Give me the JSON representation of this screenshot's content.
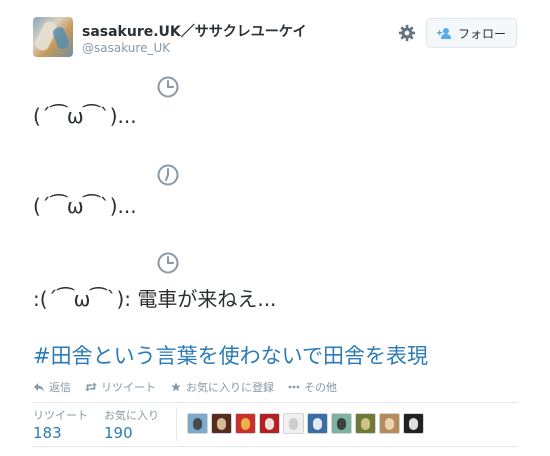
{
  "user": {
    "display_name": "sasakure.UK／ササクレユーケイ",
    "username": "@sasakure_UK",
    "follow_label": "フォロー"
  },
  "tweet": {
    "lines": [
      "(´⁀ω⁀`)...",
      "(´⁀ω⁀`)...",
      ":(´⁀ω⁀`): 電車が来ねえ..."
    ],
    "hashtag": "#田舎という言葉を使わないで田舎を表現"
  },
  "actions": {
    "reply": "返信",
    "retweet": "リツイート",
    "favorite": "お気に入りに登録",
    "more": "その他"
  },
  "stats": {
    "retweets_label": "リツイート",
    "retweets_value": "183",
    "favorites_label": "お気に入り",
    "favorites_value": "190"
  },
  "colors": {
    "link": "#2b7bb9",
    "muted": "#8899a6",
    "text": "#292f33"
  },
  "favoriter_avatars": [
    {
      "bg": "#7fa9c9",
      "fg": "#3a3a3a"
    },
    {
      "bg": "#5a2a1e",
      "fg": "#e9d2b0"
    },
    {
      "bg": "#c9302c",
      "fg": "#f2c94c"
    },
    {
      "bg": "#b22222",
      "fg": "#ffffff"
    },
    {
      "bg": "#f0f0f0",
      "fg": "#c8c8c8"
    },
    {
      "bg": "#3a6ea5",
      "fg": "#ffffff"
    },
    {
      "bg": "#7fb3a0",
      "fg": "#2e2e2e"
    },
    {
      "bg": "#6f7a3a",
      "fg": "#e0d090"
    },
    {
      "bg": "#b68a5a",
      "fg": "#f0e0c0"
    },
    {
      "bg": "#222222",
      "fg": "#ffffff"
    }
  ]
}
